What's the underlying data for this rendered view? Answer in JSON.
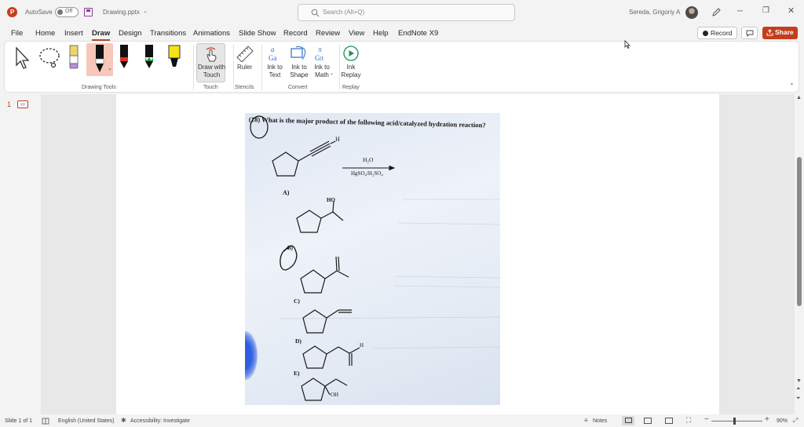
{
  "title_bar": {
    "autosave_label": "AutoSave",
    "autosave_state": "Off",
    "filename": "Drawing.pptx",
    "search_placeholder": "Search (Alt+Q)",
    "user_name": "Sereda, Grigoriy A"
  },
  "menu": {
    "tabs": [
      "File",
      "Home",
      "Insert",
      "Draw",
      "Design",
      "Transitions",
      "Animations",
      "Slide Show",
      "Record",
      "Review",
      "View",
      "Help",
      "EndNote X9"
    ],
    "active_tab": "Draw",
    "record_button": "Record",
    "share_button": "Share"
  },
  "ribbon": {
    "groups": {
      "drawing_tools": "Drawing Tools",
      "touch": "Touch",
      "stencils": "Stencils",
      "convert": "Convert",
      "replay": "Replay"
    },
    "buttons": {
      "draw_with_touch": "Draw with Touch",
      "ruler": "Ruler",
      "ink_to_text": "Ink to Text",
      "ink_to_shape": "Ink to Shape",
      "ink_to_math": "Ink to Math",
      "ink_replay": "Ink Replay"
    }
  },
  "thumbnails": {
    "slide_number": "1"
  },
  "slide": {
    "question": "(18) What is the major product of the following acid/catalyzed hydration reaction?",
    "reagent_top": "H₂O",
    "reagent_bottom": "HgSO₄/H₂SO₄",
    "alkyne_h": "H",
    "choice_a": "A)",
    "choice_a_group": "HO",
    "choice_b": "B)",
    "choice_c": "C)",
    "choice_d": "D)",
    "choice_d_h": "H",
    "choice_e": "E)",
    "choice_e_group": "OH"
  },
  "status_bar": {
    "slide_info": "Slide 1 of 1",
    "language": "English (United States)",
    "accessibility": "Accessibility: Investigate",
    "notes": "Notes",
    "zoom": "90%"
  },
  "colors": {
    "accent": "#b7472a",
    "share_button": "#c43e1c",
    "slide_photo_bg": "#dfe7f3"
  }
}
